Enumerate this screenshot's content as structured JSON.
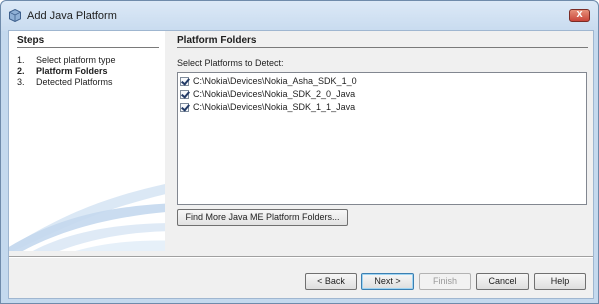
{
  "window": {
    "title": "Add Java Platform",
    "close_glyph": "x"
  },
  "steps": {
    "title": "Steps",
    "items": [
      {
        "num": "1.",
        "label": "Select platform type"
      },
      {
        "num": "2.",
        "label": "Platform Folders"
      },
      {
        "num": "3.",
        "label": "Detected Platforms"
      }
    ]
  },
  "main": {
    "title": "Platform Folders",
    "list_label": "Select Platforms to Detect:",
    "platforms": [
      {
        "path": "C:\\Nokia\\Devices\\Nokia_Asha_SDK_1_0",
        "checked": true
      },
      {
        "path": "C:\\Nokia\\Devices\\Nokia_SDK_2_0_Java",
        "checked": true
      },
      {
        "path": "C:\\Nokia\\Devices\\Nokia_SDK_1_1_Java",
        "checked": true
      }
    ],
    "find_more_label": "Find More Java ME Platform Folders..."
  },
  "buttons": {
    "back": "< Back",
    "next": "Next >",
    "finish": "Finish",
    "cancel": "Cancel",
    "help": "Help"
  },
  "colors": {
    "title_bar": "#c8dbef",
    "default_button_border": "#3c7fb1"
  }
}
